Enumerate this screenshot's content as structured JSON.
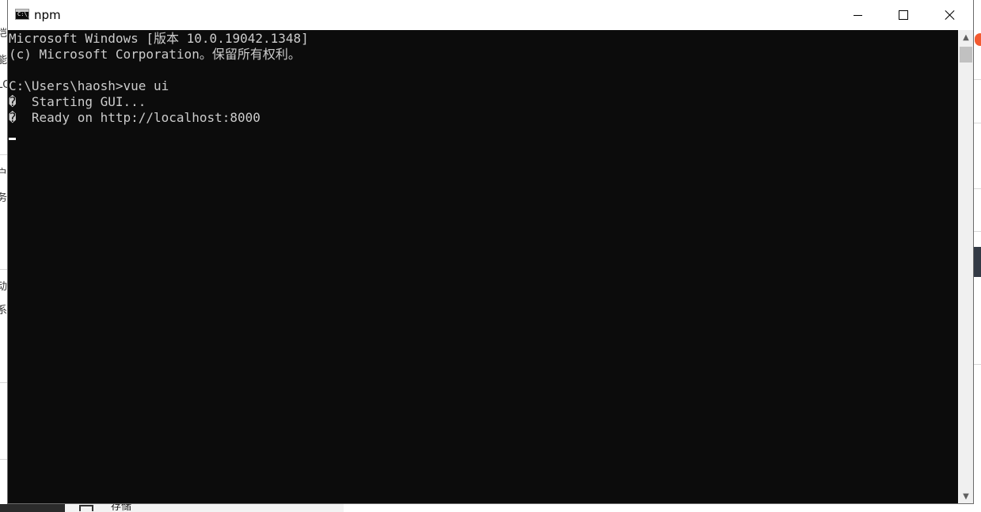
{
  "window": {
    "title": "npm",
    "icon_label": "C:\\_"
  },
  "console": {
    "lines": [
      "Microsoft Windows [版本 10.0.19042.1348]",
      "(c) Microsoft Corporation。保留所有权利。",
      "",
      "C:\\Users\\haosh>vue ui",
      "�  Starting GUI...",
      "�  Ready on http://localhost:8000"
    ]
  },
  "titlebar_buttons": {
    "minimize": "minimize-icon",
    "maximize": "maximize-icon",
    "close": "close-icon"
  },
  "scrollbar": {
    "up": "▲",
    "down": "▼"
  },
  "background": {
    "left_glyphs": [
      "垲",
      "能",
      "LC",
      "户",
      "务",
      "动",
      "系"
    ],
    "bottom_text": "存储"
  },
  "colors": {
    "console_bg": "#0c0c0c",
    "console_text": "#cccccc",
    "titlebar_bg": "#ffffff"
  }
}
